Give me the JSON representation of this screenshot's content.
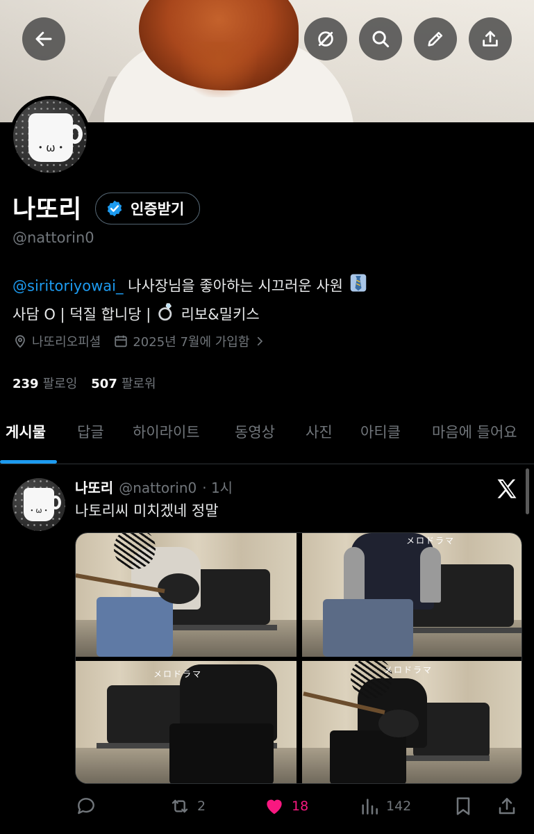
{
  "profile": {
    "name": "나또리",
    "handle": "@nattorin0",
    "verify_label": "인증받기",
    "bio_mention": "@siritoriyowai_",
    "bio_line1": "나사장님을 좋아하는 시끄러운 사원",
    "bio_line2_a": "사담 O | 덕질 합니당 | ",
    "bio_line2_b": "리보&밀키스",
    "location": "나또리오피셜",
    "joined": "2025년 7월에 가입함",
    "following_count": "239",
    "following_label": "팔로잉",
    "followers_count": "507",
    "followers_label": "팔로워"
  },
  "tabs": [
    "게시물",
    "답글",
    "하이라이트",
    "동영상",
    "사진",
    "아티클",
    "마음에 들어요"
  ],
  "post": {
    "name": "나또리",
    "handle": "@nattorin0",
    "time": "· 1시",
    "text": "나토리씨 미치겠네 정말",
    "captions": [
      "メロドラマ",
      "メロドラマ",
      "メロドラマ"
    ],
    "retweets": "2",
    "likes": "18",
    "views": "142"
  },
  "colors": {
    "accent": "#1d9bf0",
    "like": "#f91880",
    "muted": "#71767b"
  },
  "icons": [
    "back-arrow-icon",
    "translate-off-icon",
    "search-icon",
    "edit-pencil-icon",
    "share-upload-icon",
    "verified-badge-icon",
    "location-pin-icon",
    "calendar-icon",
    "chevron-right-icon",
    "x-logo-icon",
    "reply-icon",
    "retweet-icon",
    "heart-icon",
    "views-icon",
    "bookmark-icon",
    "share-icon"
  ]
}
